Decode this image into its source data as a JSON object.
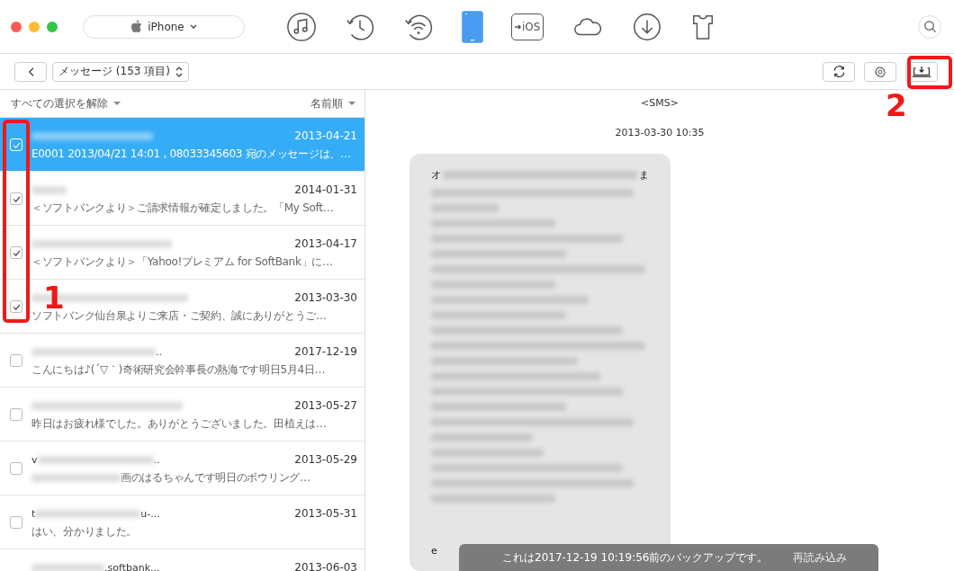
{
  "device": {
    "name": "iPhone"
  },
  "nav": [
    {
      "kind": "music",
      "selected": false
    },
    {
      "kind": "history",
      "selected": false
    },
    {
      "kind": "wireless",
      "selected": false
    },
    {
      "kind": "phone",
      "selected": true
    },
    {
      "kind": "ios",
      "label": "iOS",
      "selected": false
    },
    {
      "kind": "cloud",
      "selected": false
    },
    {
      "kind": "download",
      "selected": false
    },
    {
      "kind": "shirt",
      "selected": false
    }
  ],
  "category": {
    "label": "メッセージ (153 項目)"
  },
  "list_header": {
    "select_action": "すべての選択を解除",
    "sort": "名前順"
  },
  "messages": [
    {
      "date": "2013-04-21",
      "preview": "E0001 2013/04/21 14:01 , 08033345603 宛のメッセージは、…",
      "checked": true,
      "selected": true
    },
    {
      "date": "2014-01-31",
      "preview": "＜ソフトバンクより＞ご請求情報が確定しました。「My Soft…",
      "checked": true,
      "selected": false
    },
    {
      "date": "2013-04-17",
      "preview": "＜ソフトバンクより＞「Yahoo!プレミアム for SoftBank」に…",
      "checked": true,
      "selected": false
    },
    {
      "date": "2013-03-30",
      "preview": "ソフトバンク仙台泉よりご来店・ご契約、誠にありがとうご…",
      "checked": true,
      "selected": false
    },
    {
      "sender_tail": "..",
      "date": "2017-12-19",
      "preview": "こんにちは♪(´▽｀)奇術研究会幹事長の熱海です明日5月4日…",
      "checked": false,
      "selected": false
    },
    {
      "date": "2013-05-27",
      "preview": "昨日はお疲れ様でした。ありがとうございました。田植えは…",
      "checked": false,
      "selected": false
    },
    {
      "sender_head": "v",
      "sender_tail": "..",
      "date": "2013-05-29",
      "preview": "画のはるちゃんです明日のボウリング…",
      "checked": false,
      "selected": false
    },
    {
      "sender_head": "t",
      "sender_tail": "u-...",
      "date": "2013-05-31",
      "preview": "はい、分かりました。",
      "checked": false,
      "selected": false
    },
    {
      "sender_tail": ".softbank...",
      "date": "2013-06-03",
      "selected": false
    }
  ],
  "conversation": {
    "title": "<SMS>",
    "timestamp": "2013-03-30 10:35",
    "bubble_first_char": "オ",
    "bubble_first_end": "ま",
    "bubble_footer": "e"
  },
  "toast": {
    "text": "これは2017-12-19 10:19:56前のバックアップです。",
    "action": "再読み込み"
  },
  "annotations": [
    {
      "label": "1"
    },
    {
      "label": "2"
    }
  ]
}
